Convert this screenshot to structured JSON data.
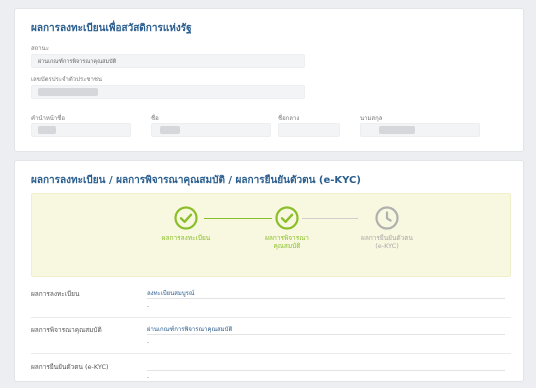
{
  "section1": {
    "title": "ผลการลงทะเบียนเพื่อสวัสดิการแห่งรัฐ",
    "status_label": "สถานะ",
    "status_value": "ผ่านเกณฑ์การพิจารณาคุณสมบัติ",
    "id_label": "เลขบัตรประจำตัวประชาชน",
    "prefix_label": "คำนำหน้าชื่อ",
    "firstname_label": "ชื่อ",
    "middlename_label": "ชื่อกลาง",
    "lastname_label": "นามสกุล"
  },
  "section2": {
    "title": "ผลการลงทะเบียน / ผลการพิจารณาคุณสมบัติ / ผลการยืนยันตัวตน (e-KYC)",
    "steps": [
      {
        "line1": "ผลการลงทะเบียน",
        "line2": "",
        "state": "done",
        "icon": "check-circle-icon"
      },
      {
        "line1": "ผลการพิจารณา",
        "line2": "คุณสมบัติ",
        "state": "done",
        "icon": "check-circle-icon"
      },
      {
        "line1": "ผลการยืนยันตัวตน",
        "line2": "(e-KYC)",
        "state": "pending",
        "icon": "clock-icon"
      }
    ],
    "rows": [
      {
        "label": "ผลการลงทะเบียน",
        "value": "ลงทะเบียนสมบูรณ์",
        "sub": "-"
      },
      {
        "label": "ผลการพิจารณาคุณสมบัติ",
        "value": "ผ่านเกณฑ์การพิจารณาคุณสมบัติ",
        "sub": "-"
      },
      {
        "label": "ผลการยืนยันตัวตน (e-KYC)",
        "value": "",
        "sub": "-"
      }
    ]
  },
  "colors": {
    "title": "#2b5e8e",
    "done": "#8bbf2a",
    "pending": "#a8a8a8",
    "steps_background": "#f8f8e0"
  }
}
